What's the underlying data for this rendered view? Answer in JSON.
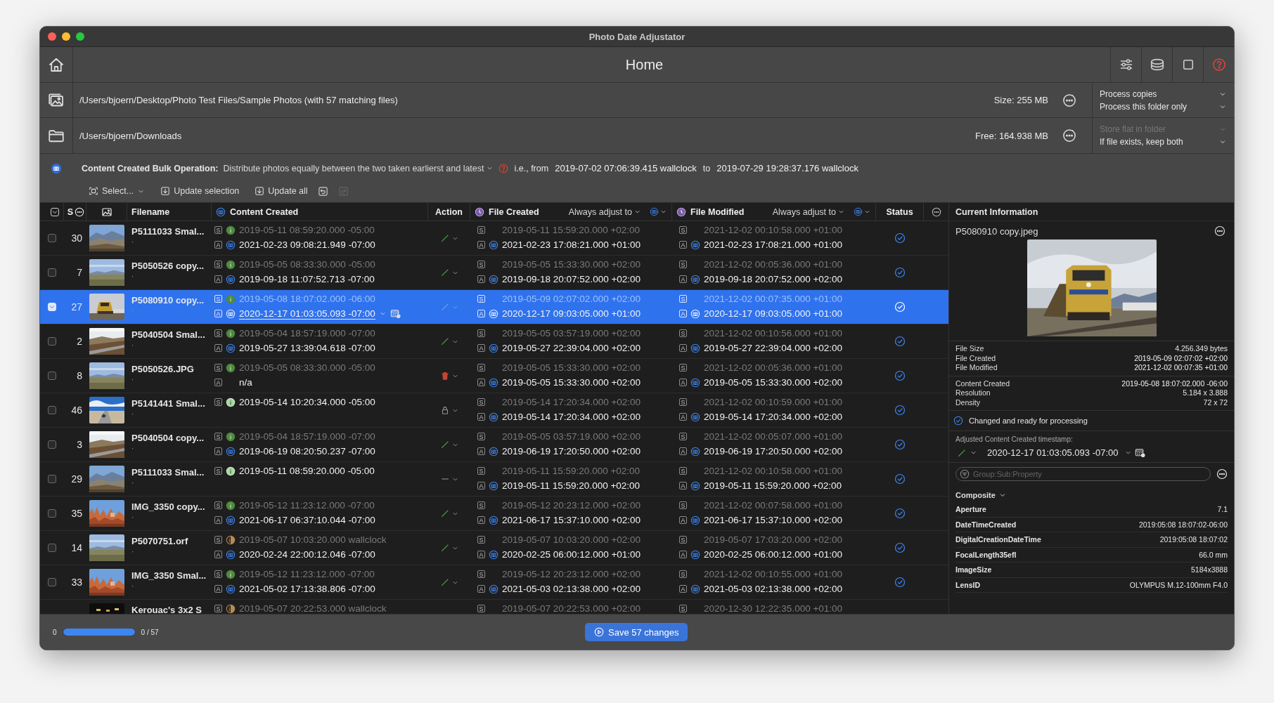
{
  "window": {
    "title": "Photo Date Adjustator"
  },
  "toolbar": {
    "title": "Home"
  },
  "source": {
    "path": "/Users/bjoern/Desktop/Photo Test Files/Sample Photos (with 57 matching files)",
    "size": "Size: 255 MB",
    "options": [
      {
        "label": "Process copies",
        "disabled": false
      },
      {
        "label": "Process this folder only",
        "disabled": false
      }
    ]
  },
  "destination": {
    "path": "/Users/bjoern/Downloads",
    "size": "Free: 164.938 MB",
    "options": [
      {
        "label": "Store flat in folder",
        "disabled": true
      },
      {
        "label": "If file exists, keep both",
        "disabled": false
      }
    ]
  },
  "bulk": {
    "label": "Content Created Bulk Operation:",
    "mode": "Distribute photos equally between the two taken earlierst and latest",
    "prefix": "i.e., from",
    "from": {
      "date": "2019-07-02",
      "time": "07:06:39",
      "ms": ".415",
      "tz": "wallclock"
    },
    "joiner": "to",
    "to": {
      "date": "2019-07-29",
      "time": "19:28:37",
      "ms": ".176",
      "tz": "wallclock"
    }
  },
  "actions": [
    {
      "label": "Select...",
      "kind": "select"
    },
    {
      "label": "Update selection",
      "kind": "update"
    },
    {
      "label": "Update all",
      "kind": "update"
    }
  ],
  "history_buttons": [
    {
      "disabled": false
    },
    {
      "disabled": true
    }
  ],
  "table": {
    "header_checked": true,
    "columns": {
      "sort": "S",
      "filename": "Filename",
      "content": "Content Created",
      "action": "Action",
      "file_created": "File Created",
      "file_modified": "File Modified",
      "status": "Status"
    },
    "adjust_modes": [
      "Always adjust to",
      "Always adjust to"
    ],
    "rows": [
      {
        "kind": "edit",
        "checked": false,
        "selected": false,
        "number": "30",
        "filename": "P5111033 Smal...",
        "sub": "·",
        "content": [
          {
            "mark": "S",
            "kind": "exif",
            "dim": true,
            "date": "2019-05-11",
            "time": "08:59:20",
            "ms": ".000",
            "tz": "-05:00"
          },
          {
            "mark": "A",
            "kind": "adjusted",
            "date": "2021-02-23",
            "time": "09:08:21",
            "ms": ".949",
            "tz": "-07:00"
          }
        ],
        "file_created": [
          {
            "mark": "S",
            "kind": "file",
            "dim": true,
            "date": "2019-05-11",
            "time": "15:59:20",
            "ms": ".000",
            "tz": "+02:00"
          },
          {
            "mark": "A",
            "kind": "adjusted",
            "date": "2021-02-23",
            "time": "17:08:21",
            "ms": ".000",
            "tz": "+01:00"
          }
        ],
        "file_modified": [
          {
            "mark": "S",
            "kind": "file",
            "dim": true,
            "date": "2021-12-02",
            "time": "00:10:58",
            "ms": ".000",
            "tz": "+01:00"
          },
          {
            "mark": "A",
            "kind": "adjusted",
            "date": "2021-02-23",
            "time": "17:08:21",
            "ms": ".000",
            "tz": "+01:00"
          }
        ]
      },
      {
        "kind": "edit",
        "checked": false,
        "selected": false,
        "number": "7",
        "filename": "P5050526 copy...",
        "sub": "·",
        "content": [
          {
            "mark": "S",
            "kind": "exif",
            "dim": true,
            "date": "2019-05-05",
            "time": "08:33:30",
            "ms": ".000",
            "tz": "-05:00"
          },
          {
            "mark": "A",
            "kind": "adjusted",
            "date": "2019-09-18",
            "time": "11:07:52",
            "ms": ".713",
            "tz": "-07:00"
          }
        ],
        "file_created": [
          {
            "mark": "S",
            "kind": "file",
            "dim": true,
            "date": "2019-05-05",
            "time": "15:33:30",
            "ms": ".000",
            "tz": "+02:00"
          },
          {
            "mark": "A",
            "kind": "adjusted",
            "date": "2019-09-18",
            "time": "20:07:52",
            "ms": ".000",
            "tz": "+02:00"
          }
        ],
        "file_modified": [
          {
            "mark": "S",
            "kind": "file",
            "dim": true,
            "date": "2021-12-02",
            "time": "00:05:36",
            "ms": ".000",
            "tz": "+01:00"
          },
          {
            "mark": "A",
            "kind": "adjusted",
            "date": "2019-09-18",
            "time": "20:07:52",
            "ms": ".000",
            "tz": "+02:00"
          }
        ]
      },
      {
        "kind": "edit",
        "checked": true,
        "selected": true,
        "number": "27",
        "filename": "P5080910 copy...",
        "sub": "·",
        "content": [
          {
            "mark": "S",
            "kind": "exif",
            "dim": true,
            "date": "2019-05-08",
            "time": "18:07:02",
            "ms": ".000",
            "tz": "-06:00"
          },
          {
            "mark": "A",
            "kind": "adjusted",
            "selected_part": "2020",
            "date": "-12-17",
            "time": "01:03:05",
            "ms": ".093",
            "tz": "-07:00",
            "editable": true
          }
        ],
        "file_created": [
          {
            "mark": "S",
            "kind": "file",
            "dim": true,
            "date": "2019-05-09",
            "time": "02:07:02",
            "ms": ".000",
            "tz": "+02:00"
          },
          {
            "mark": "A",
            "kind": "adjusted",
            "date": "2020-12-17",
            "time": "09:03:05",
            "ms": ".000",
            "tz": "+01:00"
          }
        ],
        "file_modified": [
          {
            "mark": "S",
            "kind": "file",
            "dim": true,
            "date": "2021-12-02",
            "time": "00:07:35",
            "ms": ".000",
            "tz": "+01:00"
          },
          {
            "mark": "A",
            "kind": "adjusted",
            "date": "2020-12-17",
            "time": "09:03:05",
            "ms": ".000",
            "tz": "+01:00"
          }
        ]
      },
      {
        "kind": "edit",
        "checked": false,
        "selected": false,
        "number": "2",
        "filename": "P5040504 Smal...",
        "sub": "·",
        "content": [
          {
            "mark": "S",
            "kind": "exif",
            "dim": true,
            "date": "2019-05-04",
            "time": "18:57:19",
            "ms": ".000",
            "tz": "-07:00"
          },
          {
            "mark": "A",
            "kind": "adjusted",
            "date": "2019-05-27",
            "time": "13:39:04",
            "ms": ".618",
            "tz": "-07:00"
          }
        ],
        "file_created": [
          {
            "mark": "S",
            "kind": "file",
            "dim": true,
            "date": "2019-05-05",
            "time": "03:57:19",
            "ms": ".000",
            "tz": "+02:00"
          },
          {
            "mark": "A",
            "kind": "adjusted",
            "date": "2019-05-27",
            "time": "22:39:04",
            "ms": ".000",
            "tz": "+02:00"
          }
        ],
        "file_modified": [
          {
            "mark": "S",
            "kind": "file",
            "dim": true,
            "date": "2021-12-02",
            "time": "00:10:56",
            "ms": ".000",
            "tz": "+01:00"
          },
          {
            "mark": "A",
            "kind": "adjusted",
            "date": "2019-05-27",
            "time": "22:39:04",
            "ms": ".000",
            "tz": "+02:00"
          }
        ]
      },
      {
        "kind": "delete",
        "checked": false,
        "selected": false,
        "number": "8",
        "filename": "P5050526.JPG",
        "sub": "·",
        "content": [
          {
            "mark": "S",
            "kind": "exif",
            "dim": true,
            "date": "2019-05-05",
            "time": "08:33:30",
            "ms": ".000",
            "tz": "-05:00"
          },
          {
            "mark": "A",
            "kind": "missing",
            "text": "n/a"
          }
        ],
        "file_created": [
          {
            "mark": "S",
            "kind": "file",
            "dim": true,
            "date": "2019-05-05",
            "time": "15:33:30",
            "ms": ".000",
            "tz": "+02:00"
          },
          {
            "mark": "A",
            "kind": "adjusted",
            "date": "2019-05-05",
            "time": "15:33:30",
            "ms": ".000",
            "tz": "+02:00"
          }
        ],
        "file_modified": [
          {
            "mark": "S",
            "kind": "file",
            "dim": true,
            "date": "2021-12-02",
            "time": "00:05:36",
            "ms": ".000",
            "tz": "+01:00"
          },
          {
            "mark": "A",
            "kind": "adjusted",
            "date": "2019-05-05",
            "time": "15:33:30",
            "ms": ".000",
            "tz": "+02:00"
          }
        ]
      },
      {
        "kind": "lock",
        "checked": false,
        "selected": false,
        "number": "46",
        "filename": "P5141441 Smal...",
        "sub": "·",
        "content": [
          {
            "mark": "S",
            "kind": "exif-only",
            "dim": false,
            "date": "2019-05-14",
            "time": "10:20:34",
            "ms": ".000",
            "tz": "-05:00"
          }
        ],
        "file_created": [
          {
            "mark": "S",
            "kind": "file",
            "dim": true,
            "date": "2019-05-14",
            "time": "17:20:34",
            "ms": ".000",
            "tz": "+02:00"
          },
          {
            "mark": "A",
            "kind": "adjusted",
            "date": "2019-05-14",
            "time": "17:20:34",
            "ms": ".000",
            "tz": "+02:00"
          }
        ],
        "file_modified": [
          {
            "mark": "S",
            "kind": "file",
            "dim": true,
            "date": "2021-12-02",
            "time": "00:10:59",
            "ms": ".000",
            "tz": "+01:00"
          },
          {
            "mark": "A",
            "kind": "adjusted",
            "date": "2019-05-14",
            "time": "17:20:34",
            "ms": ".000",
            "tz": "+02:00"
          }
        ]
      },
      {
        "kind": "edit",
        "checked": false,
        "selected": false,
        "number": "3",
        "filename": "P5040504 copy...",
        "sub": "·",
        "content": [
          {
            "mark": "S",
            "kind": "exif",
            "dim": true,
            "date": "2019-05-04",
            "time": "18:57:19",
            "ms": ".000",
            "tz": "-07:00"
          },
          {
            "mark": "A",
            "kind": "adjusted",
            "date": "2019-06-19",
            "time": "08:20:50",
            "ms": ".237",
            "tz": "-07:00"
          }
        ],
        "file_created": [
          {
            "mark": "S",
            "kind": "file",
            "dim": true,
            "date": "2019-05-05",
            "time": "03:57:19",
            "ms": ".000",
            "tz": "+02:00"
          },
          {
            "mark": "A",
            "kind": "adjusted",
            "date": "2019-06-19",
            "time": "17:20:50",
            "ms": ".000",
            "tz": "+02:00"
          }
        ],
        "file_modified": [
          {
            "mark": "S",
            "kind": "file",
            "dim": true,
            "date": "2021-12-02",
            "time": "00:05:07",
            "ms": ".000",
            "tz": "+01:00"
          },
          {
            "mark": "A",
            "kind": "adjusted",
            "date": "2019-06-19",
            "time": "17:20:50",
            "ms": ".000",
            "tz": "+02:00"
          }
        ]
      },
      {
        "kind": "none",
        "checked": false,
        "selected": false,
        "number": "29",
        "filename": "P5111033 Smal...",
        "sub": "·",
        "content": [
          {
            "mark": "S",
            "kind": "exif-only",
            "dim": false,
            "date": "2019-05-11",
            "time": "08:59:20",
            "ms": ".000",
            "tz": "-05:00"
          }
        ],
        "file_created": [
          {
            "mark": "S",
            "kind": "file",
            "dim": true,
            "date": "2019-05-11",
            "time": "15:59:20",
            "ms": ".000",
            "tz": "+02:00"
          },
          {
            "mark": "A",
            "kind": "adjusted",
            "date": "2019-05-11",
            "time": "15:59:20",
            "ms": ".000",
            "tz": "+02:00"
          }
        ],
        "file_modified": [
          {
            "mark": "S",
            "kind": "file",
            "dim": true,
            "date": "2021-12-02",
            "time": "00:10:58",
            "ms": ".000",
            "tz": "+01:00"
          },
          {
            "mark": "A",
            "kind": "adjusted",
            "date": "2019-05-11",
            "time": "15:59:20",
            "ms": ".000",
            "tz": "+02:00"
          }
        ]
      },
      {
        "kind": "edit",
        "checked": false,
        "selected": false,
        "number": "35",
        "filename": "IMG_3350 copy...",
        "sub": "·",
        "content": [
          {
            "mark": "S",
            "kind": "exif",
            "dim": true,
            "date": "2019-05-12",
            "time": "11:23:12",
            "ms": ".000",
            "tz": "-07:00"
          },
          {
            "mark": "A",
            "kind": "adjusted",
            "date": "2021-06-17",
            "time": "06:37:10",
            "ms": ".044",
            "tz": "-07:00"
          }
        ],
        "file_created": [
          {
            "mark": "S",
            "kind": "file",
            "dim": true,
            "date": "2019-05-12",
            "time": "20:23:12",
            "ms": ".000",
            "tz": "+02:00"
          },
          {
            "mark": "A",
            "kind": "adjusted",
            "date": "2021-06-17",
            "time": "15:37:10",
            "ms": ".000",
            "tz": "+02:00"
          }
        ],
        "file_modified": [
          {
            "mark": "S",
            "kind": "file",
            "dim": true,
            "date": "2021-12-02",
            "time": "00:07:58",
            "ms": ".000",
            "tz": "+01:00"
          },
          {
            "mark": "A",
            "kind": "adjusted",
            "date": "2021-06-17",
            "time": "15:37:10",
            "ms": ".000",
            "tz": "+02:00"
          }
        ]
      },
      {
        "kind": "edit",
        "checked": false,
        "selected": false,
        "number": "14",
        "filename": "P5070751.orf",
        "sub": "·",
        "content": [
          {
            "mark": "S",
            "kind": "wallclock",
            "dim": true,
            "date": "2019-05-07",
            "time": "10:03:20",
            "ms": ".000",
            "tz": "wallclock"
          },
          {
            "mark": "A",
            "kind": "adjusted",
            "date": "2020-02-24",
            "time": "22:00:12",
            "ms": ".046",
            "tz": "-07:00"
          }
        ],
        "file_created": [
          {
            "mark": "S",
            "kind": "file",
            "dim": true,
            "date": "2019-05-07",
            "time": "10:03:20",
            "ms": ".000",
            "tz": "+02:00"
          },
          {
            "mark": "A",
            "kind": "adjusted",
            "date": "2020-02-25",
            "time": "06:00:12",
            "ms": ".000",
            "tz": "+01:00"
          }
        ],
        "file_modified": [
          {
            "mark": "S",
            "kind": "file",
            "dim": true,
            "date": "2019-05-07",
            "time": "17:03:20",
            "ms": ".000",
            "tz": "+02:00"
          },
          {
            "mark": "A",
            "kind": "adjusted",
            "date": "2020-02-25",
            "time": "06:00:12",
            "ms": ".000",
            "tz": "+01:00"
          }
        ]
      },
      {
        "kind": "edit",
        "checked": false,
        "selected": false,
        "number": "33",
        "filename": "IMG_3350 Smal...",
        "sub": "·",
        "content": [
          {
            "mark": "S",
            "kind": "exif",
            "dim": true,
            "date": "2019-05-12",
            "time": "11:23:12",
            "ms": ".000",
            "tz": "-07:00"
          },
          {
            "mark": "A",
            "kind": "adjusted",
            "date": "2021-05-02",
            "time": "17:13:38",
            "ms": ".806",
            "tz": "-07:00"
          }
        ],
        "file_created": [
          {
            "mark": "S",
            "kind": "file",
            "dim": true,
            "date": "2019-05-12",
            "time": "20:23:12",
            "ms": ".000",
            "tz": "+02:00"
          },
          {
            "mark": "A",
            "kind": "adjusted",
            "date": "2021-05-03",
            "time": "02:13:38",
            "ms": ".000",
            "tz": "+02:00"
          }
        ],
        "file_modified": [
          {
            "mark": "S",
            "kind": "file",
            "dim": true,
            "date": "2021-12-02",
            "time": "00:10:55",
            "ms": ".000",
            "tz": "+01:00"
          },
          {
            "mark": "A",
            "kind": "adjusted",
            "date": "2021-05-03",
            "time": "02:13:38",
            "ms": ".000",
            "tz": "+02:00"
          }
        ]
      },
      {
        "kind": "partial",
        "selected": false,
        "filename": "Kerouac's 3x2 S",
        "content": [
          {
            "mark": "S",
            "kind": "wallclock",
            "dim": true,
            "date": "2019-05-07",
            "time": "20:22:53",
            "ms": ".000",
            "tz": "wallclock"
          }
        ],
        "file_created": [
          {
            "mark": "S",
            "kind": "file",
            "dim": true,
            "date": "2019-05-07",
            "time": "20:22:53",
            "ms": ".000",
            "tz": "+02:00"
          }
        ],
        "file_modified": [
          {
            "mark": "S",
            "kind": "file",
            "dim": true,
            "date": "2020-12-30",
            "time": "12:22:35",
            "ms": ".000",
            "tz": "+01:00"
          }
        ]
      }
    ]
  },
  "details": {
    "title": "Current Information",
    "filename": "P5080910 copy.jpeg",
    "file_info": [
      {
        "label": "File Size",
        "value": "4.256.349 bytes"
      },
      {
        "label": "File Created",
        "date": "2019-05-09",
        "time": "02:07:02",
        "tz": "+02:00"
      },
      {
        "label": "File Modified",
        "date": "2021-12-02",
        "time": "00:07:35",
        "tz": "+01:00"
      }
    ],
    "content_info": [
      {
        "label": "Content Created",
        "date": "2019-05-08",
        "time": "18:07:02",
        "ms": ".000",
        "tz": "-06:00"
      },
      {
        "label": "Resolution",
        "value": "5.184 x 3.888"
      },
      {
        "label": "Density",
        "value": "72 x 72"
      }
    ],
    "status": "Changed and ready for processing",
    "adjusted_label": "Adjusted Content Created timestamp:",
    "adjusted": {
      "date": "2020-12-17",
      "time": "01:03:05",
      "ms": ".093",
      "tz": "-07:00"
    },
    "filter": {
      "placeholder": "Group:Sub:Property"
    },
    "group": {
      "name": "Composite",
      "expanded": true
    },
    "properties": [
      {
        "name": "Aperture",
        "value": "7.1"
      },
      {
        "name": "DateTimeCreated",
        "value": "2019:05:08 18:07:02-06:00"
      },
      {
        "name": "DigitalCreationDateTime",
        "value": "2019:05:08 18:07:02"
      },
      {
        "name": "FocalLength35efl",
        "value": "66.0 mm"
      },
      {
        "name": "ImageSize",
        "value": "5184x3888"
      },
      {
        "name": "LensID",
        "value": "OLYMPUS M.12-100mm F4.0"
      }
    ]
  },
  "footer": {
    "start": "0",
    "level": 1,
    "count": "0 / 57",
    "save": "Save 57 changes"
  }
}
